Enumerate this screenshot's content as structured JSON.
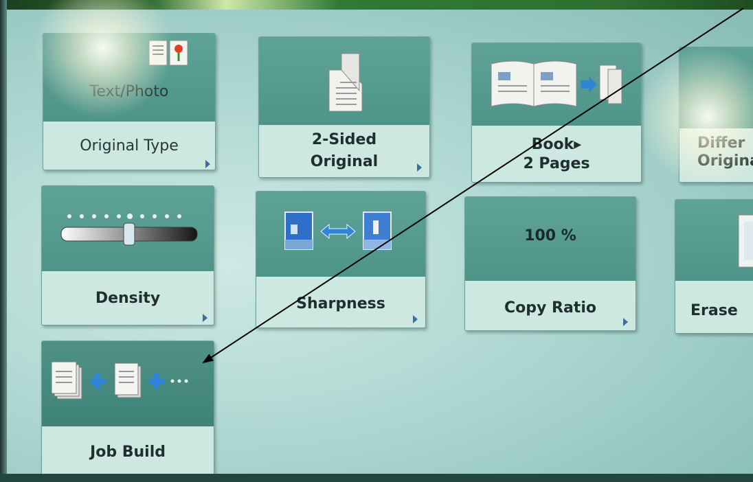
{
  "tiles": {
    "original_type": {
      "value": "Text/Photo",
      "label": "Original Type",
      "icon": "text-photo-icon"
    },
    "two_sided": {
      "label_line1": "2-Sided",
      "label_line2": "Original",
      "icon": "two-sided-page-icon"
    },
    "book": {
      "label_line1": "Book▸",
      "label_line2": "2 Pages",
      "icon": "book-to-pages-icon"
    },
    "different": {
      "label_line1": "Differ",
      "label_line2": "Origina",
      "icon": "different-sizes-icon"
    },
    "density": {
      "label": "Density",
      "icon": "density-slider-icon",
      "level": 0.5
    },
    "sharpness": {
      "label": "Sharpness",
      "icon": "sharpness-icon"
    },
    "copy_ratio": {
      "value": "100 %",
      "label": "Copy Ratio"
    },
    "erase": {
      "label": "Erase",
      "icon": "erase-frame-icon"
    },
    "job_build": {
      "label": "Job Build",
      "icon": "job-build-icon"
    }
  },
  "colors": {
    "tile_top": "#5fa398",
    "tile_bottom": "#cde7e1",
    "caret": "#3b6ea0",
    "arrow_annotation": "#000000"
  }
}
